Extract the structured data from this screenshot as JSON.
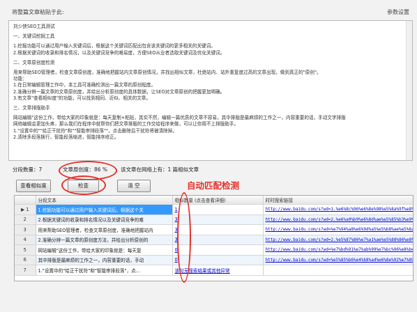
{
  "toolbar": {
    "hint": "将整篇文章粘贴于此:",
    "settings": "参数设置"
  },
  "editor": {
    "lines": [
      "刘少侠SEO工具测试",
      "",
      "一、关键词挖掘工具",
      "",
      "1.挖掘功能可以通过用户输入关键词后，根据这个关键词匹配出包含该关键词的更多相关的关键词。",
      "2.根据关键词的收录和排名情况，以及关键词竞争的难易度，方便SEO从业者选取关键词及优化关键词。",
      "",
      "二、文章原创度检测",
      "",
      "用来帮助SEO管理者，检查文章原创度，准确地把握站内文章原创情况，并找出相似文章，杜绝站内、站外重复度过高的文章出现，做到真正的\"原创\"。",
      "功能：",
      "1.在日常编辑管理工作中，本工具可准确检测出一篇文章的原创程度。",
      "2.准确分辨一篇文章的文章原创度，并给出分析原创度的具体数据，让SEO对文章原创的把握更加明确。",
      "3.有文章\"查看相似度\"的功能，可以找到相同、近似、相关的文章。",
      "",
      "三、文章排版助手",
      "",
      "网站编辑\"这份工作，带给大家的印象就是：每天复制+粘贴，其实不然，编辑一篇优质的文章不容易，其中排版是最麻烦的工作之一，内容重要的话，手动文字排版",
      "网络编辑会更加头疼，那么我们在程序中就帮你们把文章排版的工作交给程序来做，可以让你用不上排版助手。",
      "1.\"设置中的\"\"给正干扰符\"和\"\"智能审排段落\"\"，点击删除后干扰符将被清除掉。",
      "2.清除多段落换行，智能段落缩进，智能排序修正。"
    ]
  },
  "stats": {
    "segments": "分段数量：7",
    "originality": "文章原创度：86 %",
    "online": "该文章在网络上有：1 篇相似文章"
  },
  "buttons": {
    "view": "查看相似度",
    "check": "检查",
    "clear": "清 空"
  },
  "annotation": "自动匹配检测",
  "grid": {
    "headers": [
      "",
      "分段文本",
      "相似数量 (点击查看详细)",
      "时时搜索链接"
    ],
    "rows": [
      {
        "n": "1",
        "text": "1.挖掘功能可以通过用户输入关键词后，根据这个关",
        "count": "1",
        "link": "http://www.baidu.com/s?wd=1.%e6%8c%96%e6%8e%98%e5%8a%9f%e8%83%bd"
      },
      {
        "n": "2",
        "text": "2.根据关键词的收录和排名情况以及关键词竞争的难",
        "count": "3",
        "link": "http://www.baidu.com/s?wd=2.%e6%a0%b9%e6%8d%ae%e5%85%b3%e9%94%ae"
      },
      {
        "n": "3",
        "text": "用来帮助SEO管理者，检查文章原创度，准确地把握站内",
        "count": "3",
        "link": "http://www.baidu.com/s?wd=%e7%94%a8%e6%9d%a5%e5%b8%ae%e5%8a%a9SEO"
      },
      {
        "n": "4",
        "text": "2.准确分辨一篇文章的原创度方法，并给出分析原创的",
        "count": "3",
        "link": "http://www.baidu.com/s?wd=2.%e5%87%86%e7%a1%ae%e5%88%86%e8%be%a8"
      },
      {
        "n": "5",
        "text": "网站编辑\"这份工作，带给大家的印象就是：每天复",
        "count": "0",
        "link": "http://www.baidu.com/s?wd=%e7%bd%91%e7%ab%99%e7%bc%96%e8%be%91"
      },
      {
        "n": "6",
        "text": "其中排版是最麻烦的工作之一，内容重要的话，手动",
        "count": "0",
        "link": "http://www.baidu.com/s?wd=%e5%85%b6%e4%b8%ad%e6%8e%92%e7%89%88"
      },
      {
        "n": "7",
        "text": "1.\"设置中的\"给正干扰符\"和\"智能审排段落\"，点...",
        "count": "",
        "link": "该句无搜索结果或其他异常"
      }
    ]
  },
  "colors": {
    "accent_red": "#e4322b",
    "selected_row": "#3399ff",
    "link_blue": "#0000cc"
  }
}
